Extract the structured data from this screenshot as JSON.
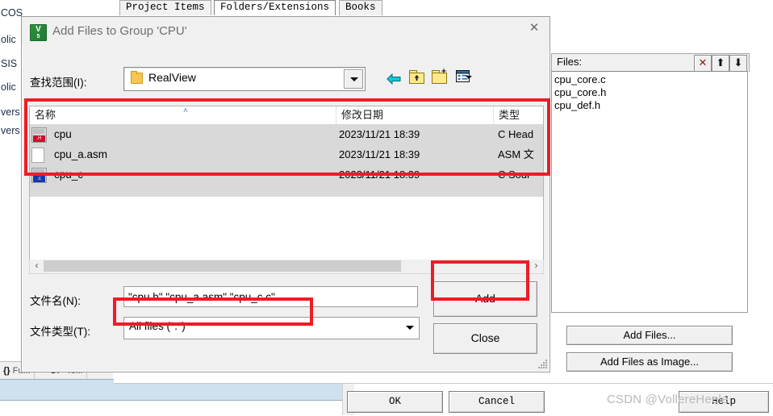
{
  "background_app": {
    "tabs": [
      {
        "label": "Project Items",
        "selected": false
      },
      {
        "label": "Folders/Extensions",
        "selected": true
      },
      {
        "label": "Books",
        "selected": false
      }
    ],
    "tree_fragments": [
      "COS",
      "olic",
      "SIS",
      "olic",
      "vers",
      "vers"
    ],
    "bottom_tabs": [
      {
        "icon": "braces-icon",
        "glyph": "{}",
        "label": "Fu..."
      },
      {
        "icon": "template-icon",
        "glyph": "U",
        "label": "Te..."
      }
    ],
    "files_panel": {
      "label": "Files:",
      "toolbar": [
        {
          "name": "delete-file-icon",
          "glyph": "✕",
          "color": "#8b1a1a"
        },
        {
          "name": "move-up-icon",
          "glyph": "⬆"
        },
        {
          "name": "move-down-icon",
          "glyph": "⬇"
        }
      ],
      "items": [
        "cpu_core.c",
        "cpu_core.h",
        "cpu_def.h"
      ]
    },
    "buttons": {
      "add_files": "Add Files...",
      "add_files_as_image": "Add Files as Image...",
      "ok": "OK",
      "cancel": "Cancel",
      "help": "Help"
    },
    "watermark": "CSDN @VollereHeele"
  },
  "dialog": {
    "title": "Add Files to Group 'CPU'",
    "icon": "uvision-logo-icon",
    "close_glyph": "✕",
    "lookin": {
      "label": "查找范围(I):",
      "value": "RealView",
      "folder_icon": "folder-icon",
      "dropdown_icon": "chevron-down-icon"
    },
    "nav_icons": [
      {
        "name": "back-arrow-icon",
        "glyph": "←"
      },
      {
        "name": "up-folder-icon"
      },
      {
        "name": "new-folder-icon"
      },
      {
        "name": "views-icon"
      }
    ],
    "list": {
      "columns": [
        "名称",
        "修改日期",
        "类型"
      ],
      "sort_indicator": "˄",
      "rows": [
        {
          "name": "cpu",
          "date": "2023/11/21 18:39",
          "type": "C Head",
          "icon": "c-header-file-icon",
          "badge": ".H",
          "badge_color": "#c8102e",
          "selected": true
        },
        {
          "name": "cpu_a.asm",
          "date": "2023/11/21 18:39",
          "type": "ASM 文",
          "icon": "plain-document-icon",
          "badge": "",
          "badge_color": "",
          "selected": true
        },
        {
          "name": "cpu_c",
          "date": "2023/11/21 18:39",
          "type": "C Sour",
          "icon": "c-source-file-icon",
          "badge": ".c",
          "badge_color": "#1638a8",
          "selected": true
        }
      ]
    },
    "scrollbar": {
      "left_glyph": "‹",
      "right_glyph": "›"
    },
    "filename": {
      "label": "文件名(N):",
      "value": "\"cpu.h\" \"cpu_a.asm\" \"cpu_c.c\""
    },
    "filetype": {
      "label": "文件类型(T):",
      "value": "All files (*.*)",
      "dropdown_icon": "chevron-down-icon"
    },
    "buttons": {
      "add": "Add",
      "close": "Close"
    }
  },
  "annotations": {
    "accent_color": "#ee1c25",
    "highlighted": [
      "file-list-rows",
      "add-button",
      "file-type-combo"
    ]
  }
}
